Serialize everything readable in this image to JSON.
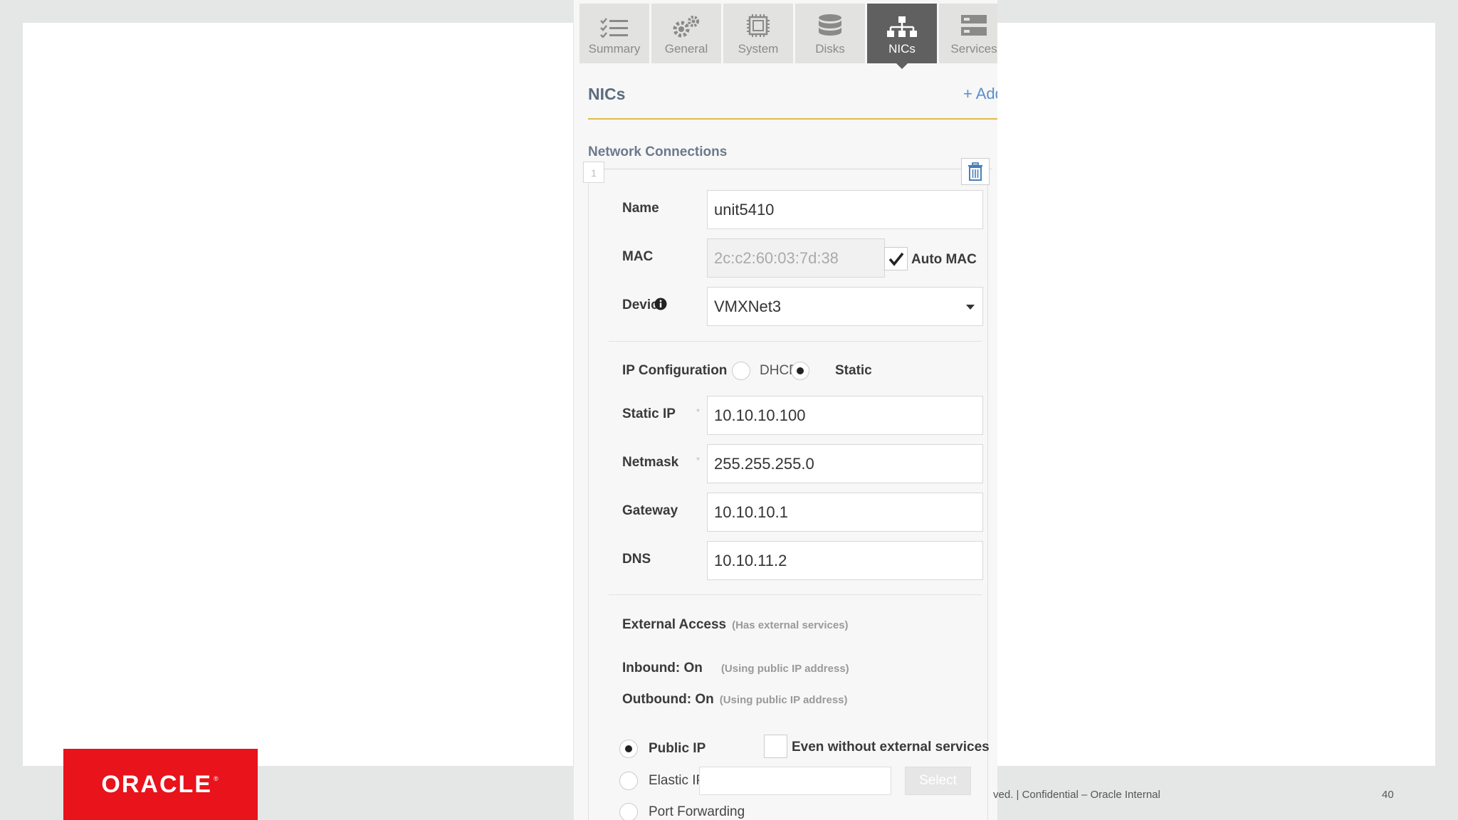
{
  "tabs": [
    {
      "label": "Summary",
      "icon": "summary-list-icon",
      "active": false
    },
    {
      "label": "General",
      "icon": "gears-icon",
      "active": false
    },
    {
      "label": "System",
      "icon": "chip-icon",
      "active": false
    },
    {
      "label": "Disks",
      "icon": "database-icon",
      "active": false
    },
    {
      "label": "NICs",
      "icon": "network-icon",
      "active": true
    },
    {
      "label": "Services",
      "icon": "services-icon",
      "active": false
    }
  ],
  "panel": {
    "title": "NICs",
    "add_label": "+ Add"
  },
  "connections": {
    "heading": "Network Connections",
    "index": "1",
    "name_label": "Name",
    "name_value": "unit5410",
    "mac_label": "MAC",
    "mac_value": "2c:c2:60:03:7d:38",
    "auto_mac_label": "Auto MAC",
    "auto_mac_checked": true,
    "device_label": "Device",
    "device_value": "VMXNet3",
    "ip_config_label": "IP Configuration",
    "dhcp_label": "DHCP",
    "static_label": "Static",
    "ip_mode": "Static",
    "required_mark": "*",
    "static_ip_label": "Static IP",
    "static_ip_value": "10.10.10.100",
    "netmask_label": "Netmask",
    "netmask_value": "255.255.255.0",
    "gateway_label": "Gateway",
    "gateway_value": "10.10.10.1",
    "dns_label": "DNS",
    "dns_value": "10.10.11.2"
  },
  "external": {
    "heading": "External Access",
    "heading_note": "(Has external services)",
    "inbound_label": "Inbound: On",
    "inbound_note": "(Using public IP address)",
    "outbound_label": "Outbound: On",
    "outbound_note": "(Using public IP address)",
    "public_ip_label": "Public IP",
    "even_without_label": "Even without external services",
    "elastic_ip_label": "Elastic IP",
    "select_label": "Select",
    "port_forwarding_label": "Port Forwarding",
    "selected": "Public IP"
  },
  "footer": {
    "text": "ved.  |  Confidential – Oracle Internal",
    "page_number": "40",
    "logo_text": "ORACLE",
    "logo_mark": "®"
  },
  "colors": {
    "oracle_red": "#e8131b",
    "accent_rule": "#e4b94a",
    "link_blue": "#5b8fc7",
    "active_tab": "#606060"
  }
}
